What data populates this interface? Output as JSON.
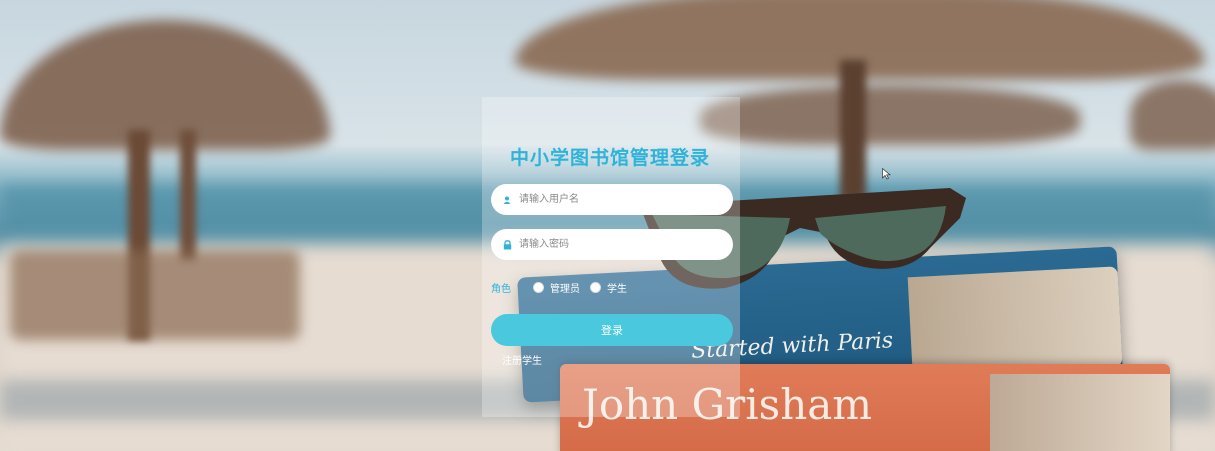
{
  "login": {
    "title": "中小学图书馆管理登录",
    "username_placeholder": "请输入用户名",
    "password_placeholder": "请输入密码",
    "role_label": "角色",
    "roles": [
      "管理员",
      "学生"
    ],
    "login_button": "登录",
    "register_link": "注册学生"
  },
  "background": {
    "book1_text": "Started with Paris",
    "book2_text": "John Grisham"
  },
  "icons": {
    "username": "user-icon",
    "password": "lock-icon"
  },
  "colors": {
    "accent": "#2fb3d8",
    "button": "#49c8de"
  }
}
